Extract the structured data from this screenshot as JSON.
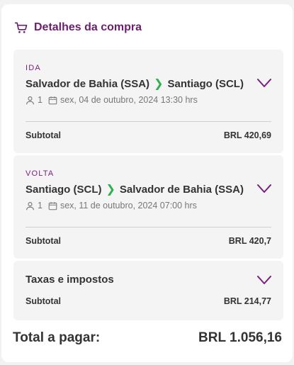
{
  "header": {
    "title": "Detalhes da compra",
    "icon": "cart-icon",
    "accent": "#6b1f6e"
  },
  "segments": [
    {
      "direction": "IDA",
      "origin": "Salvador de Bahia (SSA)",
      "destination": "Santiago (SCL)",
      "arrow": "❯",
      "passengers": "1",
      "datetime": "sex, 04 de outubro, 2024 13:30 hrs",
      "subtotal_label": "Subtotal",
      "subtotal_value": "BRL 420,69"
    },
    {
      "direction": "VOLTA",
      "origin": "Santiago (SCL)",
      "destination": "Salvador de Bahia (SSA)",
      "arrow": "❯",
      "passengers": "1",
      "datetime": "sex, 11 de outubro, 2024 07:00 hrs",
      "subtotal_label": "Subtotal",
      "subtotal_value": "BRL 420,7"
    }
  ],
  "taxes": {
    "label": "Taxas e impostos",
    "subtotal_label": "Subtotal",
    "subtotal_value": "BRL 214,77"
  },
  "total": {
    "label": "Total a pagar:",
    "value": "BRL 1.056,16"
  },
  "colors": {
    "direction": "#7a1e7f",
    "arrow": "#2bb24c",
    "chevron": "#7a1e7f"
  }
}
